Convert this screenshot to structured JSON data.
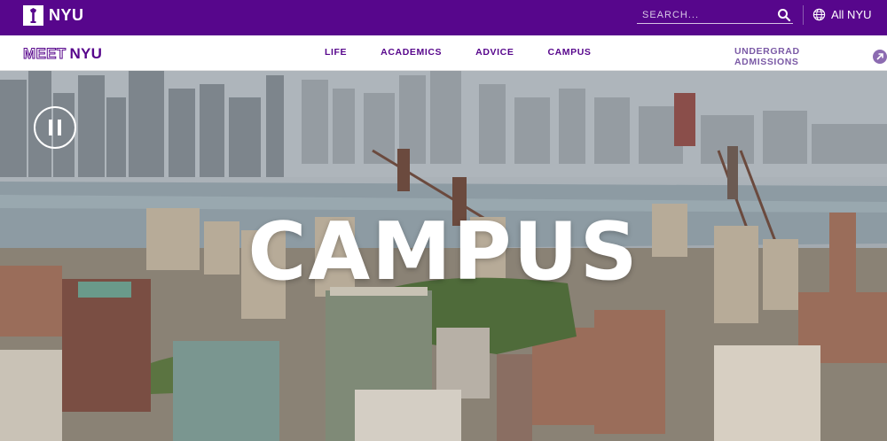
{
  "brand": {
    "logo_text": "NYU"
  },
  "search": {
    "placeholder": "SEARCH..."
  },
  "utility": {
    "all_nyu_label": "All NYU"
  },
  "subnav": {
    "meet_label": "MEET",
    "nyu_label": "NYU",
    "links": [
      {
        "label": "LIFE"
      },
      {
        "label": "ACADEMICS"
      },
      {
        "label": "ADVICE"
      },
      {
        "label": "CAMPUS"
      }
    ],
    "admissions_label": "UNDERGRAD ADMISSIONS"
  },
  "hero": {
    "title": "CAMPUS"
  },
  "colors": {
    "brand_purple": "#57068c",
    "link_purple": "#57068c",
    "admissions_purple": "#7b5aa6"
  },
  "icons": [
    "torch-icon",
    "search-icon",
    "globe-icon",
    "arrow-up-right-icon",
    "pause-icon"
  ]
}
